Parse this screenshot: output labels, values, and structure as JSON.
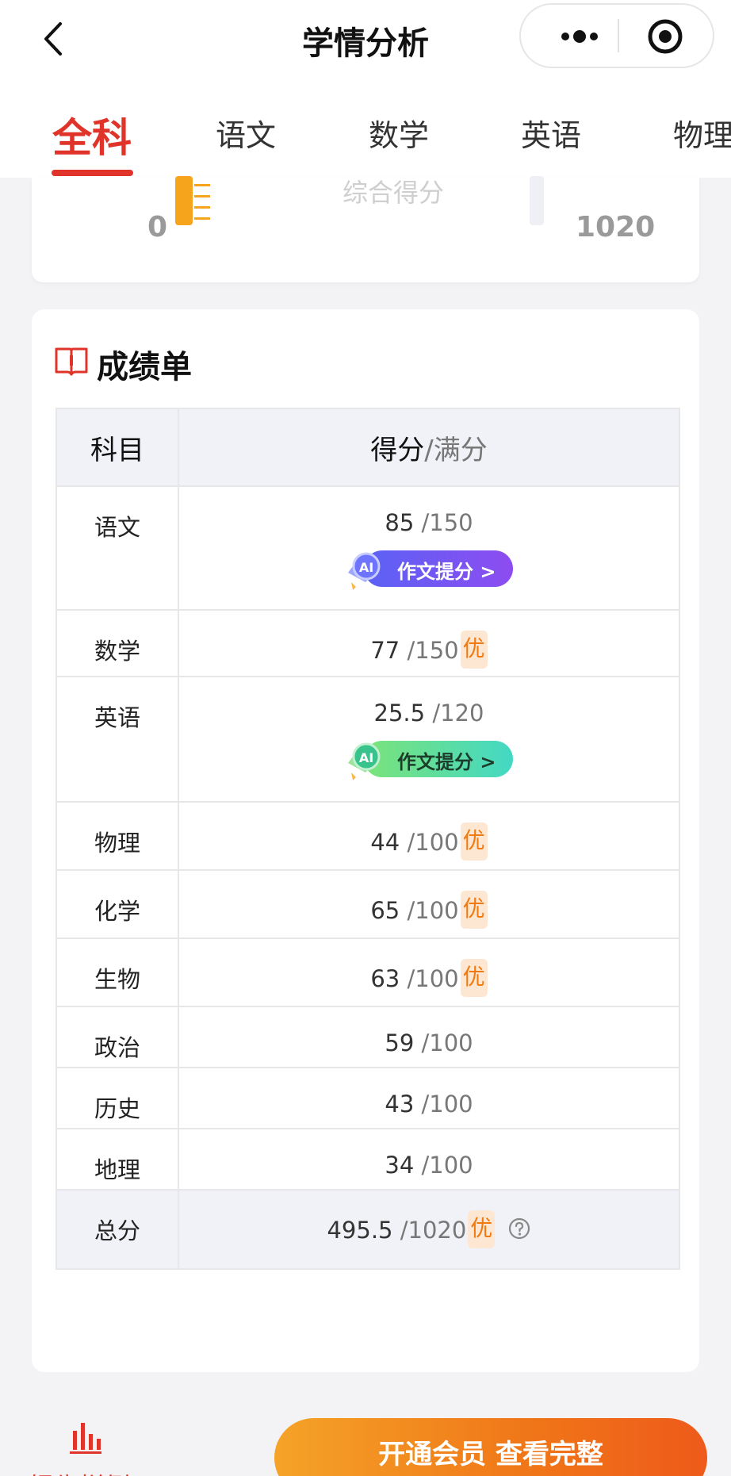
{
  "header": {
    "title": "学情分析",
    "back_icon": "chevron-left-icon",
    "more_icon": "more-dots-icon",
    "close_icon": "target-circle-icon"
  },
  "tabs": [
    {
      "label": "全科",
      "active": true
    },
    {
      "label": "语文",
      "active": false
    },
    {
      "label": "数学",
      "active": false
    },
    {
      "label": "英语",
      "active": false
    },
    {
      "label": "物理",
      "active": false
    }
  ],
  "score_card": {
    "label": "综合得分",
    "min": "0",
    "max": "1020"
  },
  "report": {
    "title": "成绩单",
    "icon": "book-icon",
    "header_subject": "科目",
    "header_score": "得分",
    "header_full": "/满分",
    "rows": [
      {
        "subject": "语文",
        "score": "85",
        "full": "/150",
        "badge": "",
        "ai": "作文提分 >",
        "ai_style": "blue"
      },
      {
        "subject": "数学",
        "score": "77",
        "full": "/150",
        "badge": "优",
        "ai": "",
        "ai_style": ""
      },
      {
        "subject": "英语",
        "score": "25.5",
        "full": "/120",
        "badge": "",
        "ai": "作文提分 >",
        "ai_style": "green"
      },
      {
        "subject": "物理",
        "score": "44",
        "full": "/100",
        "badge": "优",
        "ai": "",
        "ai_style": ""
      },
      {
        "subject": "化学",
        "score": "65",
        "full": "/100",
        "badge": "优",
        "ai": "",
        "ai_style": ""
      },
      {
        "subject": "生物",
        "score": "63",
        "full": "/100",
        "badge": "优",
        "ai": "",
        "ai_style": ""
      },
      {
        "subject": "政治",
        "score": "59",
        "full": "/100",
        "badge": "",
        "ai": "",
        "ai_style": ""
      },
      {
        "subject": "历史",
        "score": "43",
        "full": "/100",
        "badge": "",
        "ai": "",
        "ai_style": ""
      },
      {
        "subject": "地理",
        "score": "34",
        "full": "/100",
        "badge": "",
        "ai": "",
        "ai_style": ""
      }
    ],
    "total": {
      "subject": "总分",
      "score": "495.5",
      "full": "/1020",
      "badge": "优",
      "help_icon": "question-circle-icon"
    }
  },
  "bottom": {
    "sample_label": "报告样例",
    "sample_icon": "bar-chart-icon",
    "cta_label": "开通会员 查看完整"
  },
  "colors": {
    "accent": "#e0342a",
    "badge_bg": "#fde7d2",
    "badge_text": "#f07a10",
    "cta_start": "#f5a328",
    "cta_end": "#ee5a1b"
  }
}
